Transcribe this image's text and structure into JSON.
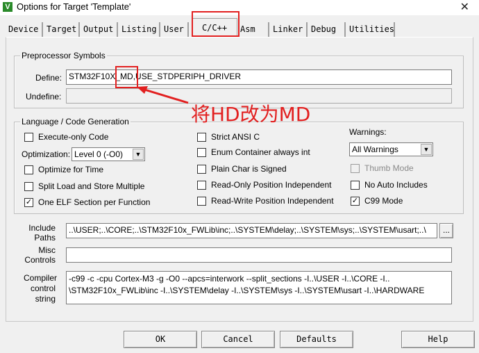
{
  "window": {
    "title": "Options for Target 'Template'",
    "close": "✕",
    "icon": "V"
  },
  "tabs": [
    {
      "label": "Device"
    },
    {
      "label": "Target"
    },
    {
      "label": "Output"
    },
    {
      "label": "Listing"
    },
    {
      "label": "User"
    },
    {
      "label": "C/C++"
    },
    {
      "label": "Asm"
    },
    {
      "label": "Linker"
    },
    {
      "label": "Debug"
    },
    {
      "label": "Utilities"
    }
  ],
  "preprocessor": {
    "title": "Preprocessor Symbols",
    "define_label": "Define:",
    "define_value": "STM32F10X_MD,USE_STDPERIPH_DRIVER",
    "undefine_label": "Undefine:",
    "undefine_value": ""
  },
  "language": {
    "title": "Language / Code Generation",
    "execute_only": "Execute-only Code",
    "optimization_label": "Optimization:",
    "optimization_value": "Level 0 (-O0)",
    "optimize_time": "Optimize for Time",
    "split_load": "Split Load and Store Multiple",
    "one_elf": "One ELF Section per Function",
    "strict_ansi": "Strict ANSI C",
    "enum_container": "Enum Container always int",
    "plain_char": "Plain Char is Signed",
    "read_only": "Read-Only Position Independent",
    "read_write": "Read-Write Position Independent",
    "warnings_label": "Warnings:",
    "warnings_value": "All Warnings",
    "thumb_mode": "Thumb Mode",
    "no_auto": "No Auto Includes",
    "c99": "C99 Mode",
    "checked": "✓"
  },
  "include": {
    "label_line1": "Include",
    "label_line2": "Paths",
    "value": "..\\USER;..\\CORE;..\\STM32F10x_FWLib\\inc;..\\SYSTEM\\delay;..\\SYSTEM\\sys;..\\SYSTEM\\usart;..\\",
    "browse": "..."
  },
  "misc": {
    "label_line1": "Misc",
    "label_line2": "Controls",
    "value": ""
  },
  "compiler": {
    "label_line1": "Compiler",
    "label_line2": "control",
    "label_line3": "string",
    "line1": "-c99 -c -cpu Cortex-M3 -g -O0 --apcs=interwork --split_sections -I..\\USER -I..\\CORE -I..",
    "line2": "\\STM32F10x_FWLib\\inc -I..\\SYSTEM\\delay -I..\\SYSTEM\\sys -I..\\SYSTEM\\usart -I..\\HARDWARE"
  },
  "buttons": {
    "ok": "OK",
    "cancel": "Cancel",
    "defaults": "Defaults",
    "help": "Help"
  },
  "annotation": {
    "text": "将HD改为MD",
    "color": "#e22020"
  }
}
